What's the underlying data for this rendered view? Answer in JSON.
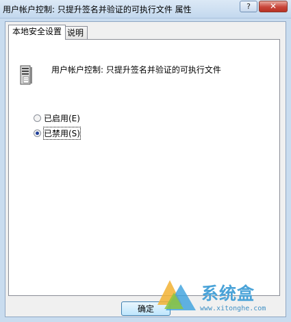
{
  "window": {
    "title": "用户帐户控制: 只提升签名并验证的可执行文件 属性",
    "help_label": "?",
    "close_label": "✕"
  },
  "tabs": [
    {
      "label": "本地安全设置",
      "active": true
    },
    {
      "label": "说明",
      "active": false
    }
  ],
  "policy": {
    "icon": "server-policy-icon",
    "title": "用户帐户控制: 只提升签名并验证的可执行文件"
  },
  "options": [
    {
      "label": "已启用(E)",
      "checked": false
    },
    {
      "label": "已禁用(S)",
      "checked": true
    }
  ],
  "buttons": {
    "ok": "确定"
  },
  "watermark": {
    "text": "系统盒",
    "url": "www.xitonghe.com"
  }
}
